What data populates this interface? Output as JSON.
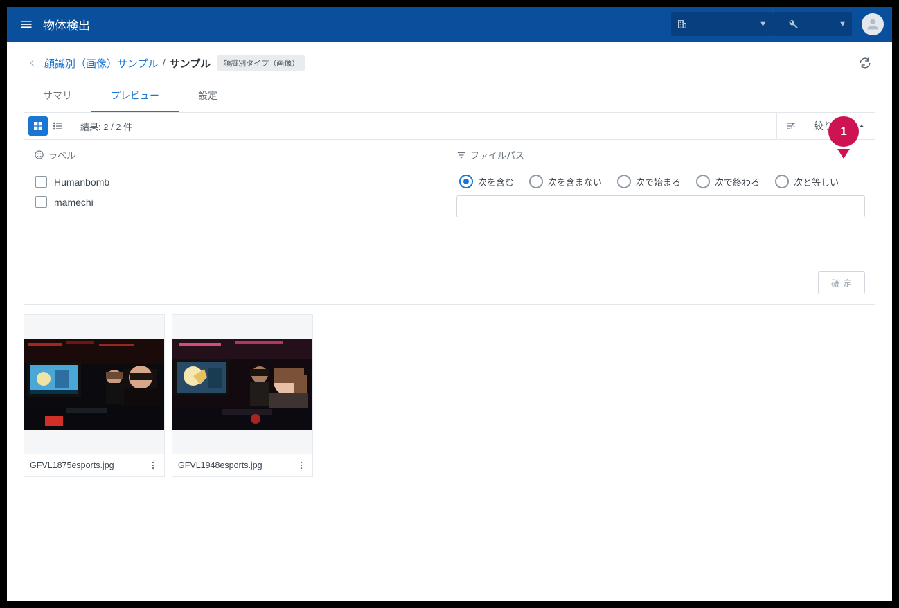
{
  "header": {
    "app_title": "物体検出"
  },
  "breadcrumb": {
    "parent": "顔識別（画像）サンプル",
    "separator": "/",
    "current": "サンプル",
    "tag": "顔識別タイプ（画像）"
  },
  "tabs": {
    "summary": "サマリ",
    "preview": "プレビュー",
    "settings": "設定"
  },
  "toolbar": {
    "result_label": "結果: 2 / 2 件",
    "filter_label": "絞り込み"
  },
  "filters": {
    "label_header": "ラベル",
    "filepath_header": "ファイルパス",
    "labels": [
      "Humanbomb",
      "mamechi"
    ],
    "filepath_options": {
      "contains": "次を含む",
      "not_contains": "次を含まない",
      "starts_with": "次で始まる",
      "ends_with": "次で終わる",
      "equals": "次と等しい"
    },
    "filepath_value": "",
    "confirm": "確定"
  },
  "results": [
    {
      "filename": "GFVL1875esports.jpg"
    },
    {
      "filename": "GFVL1948esports.jpg"
    }
  ],
  "callout": {
    "number": "1"
  }
}
